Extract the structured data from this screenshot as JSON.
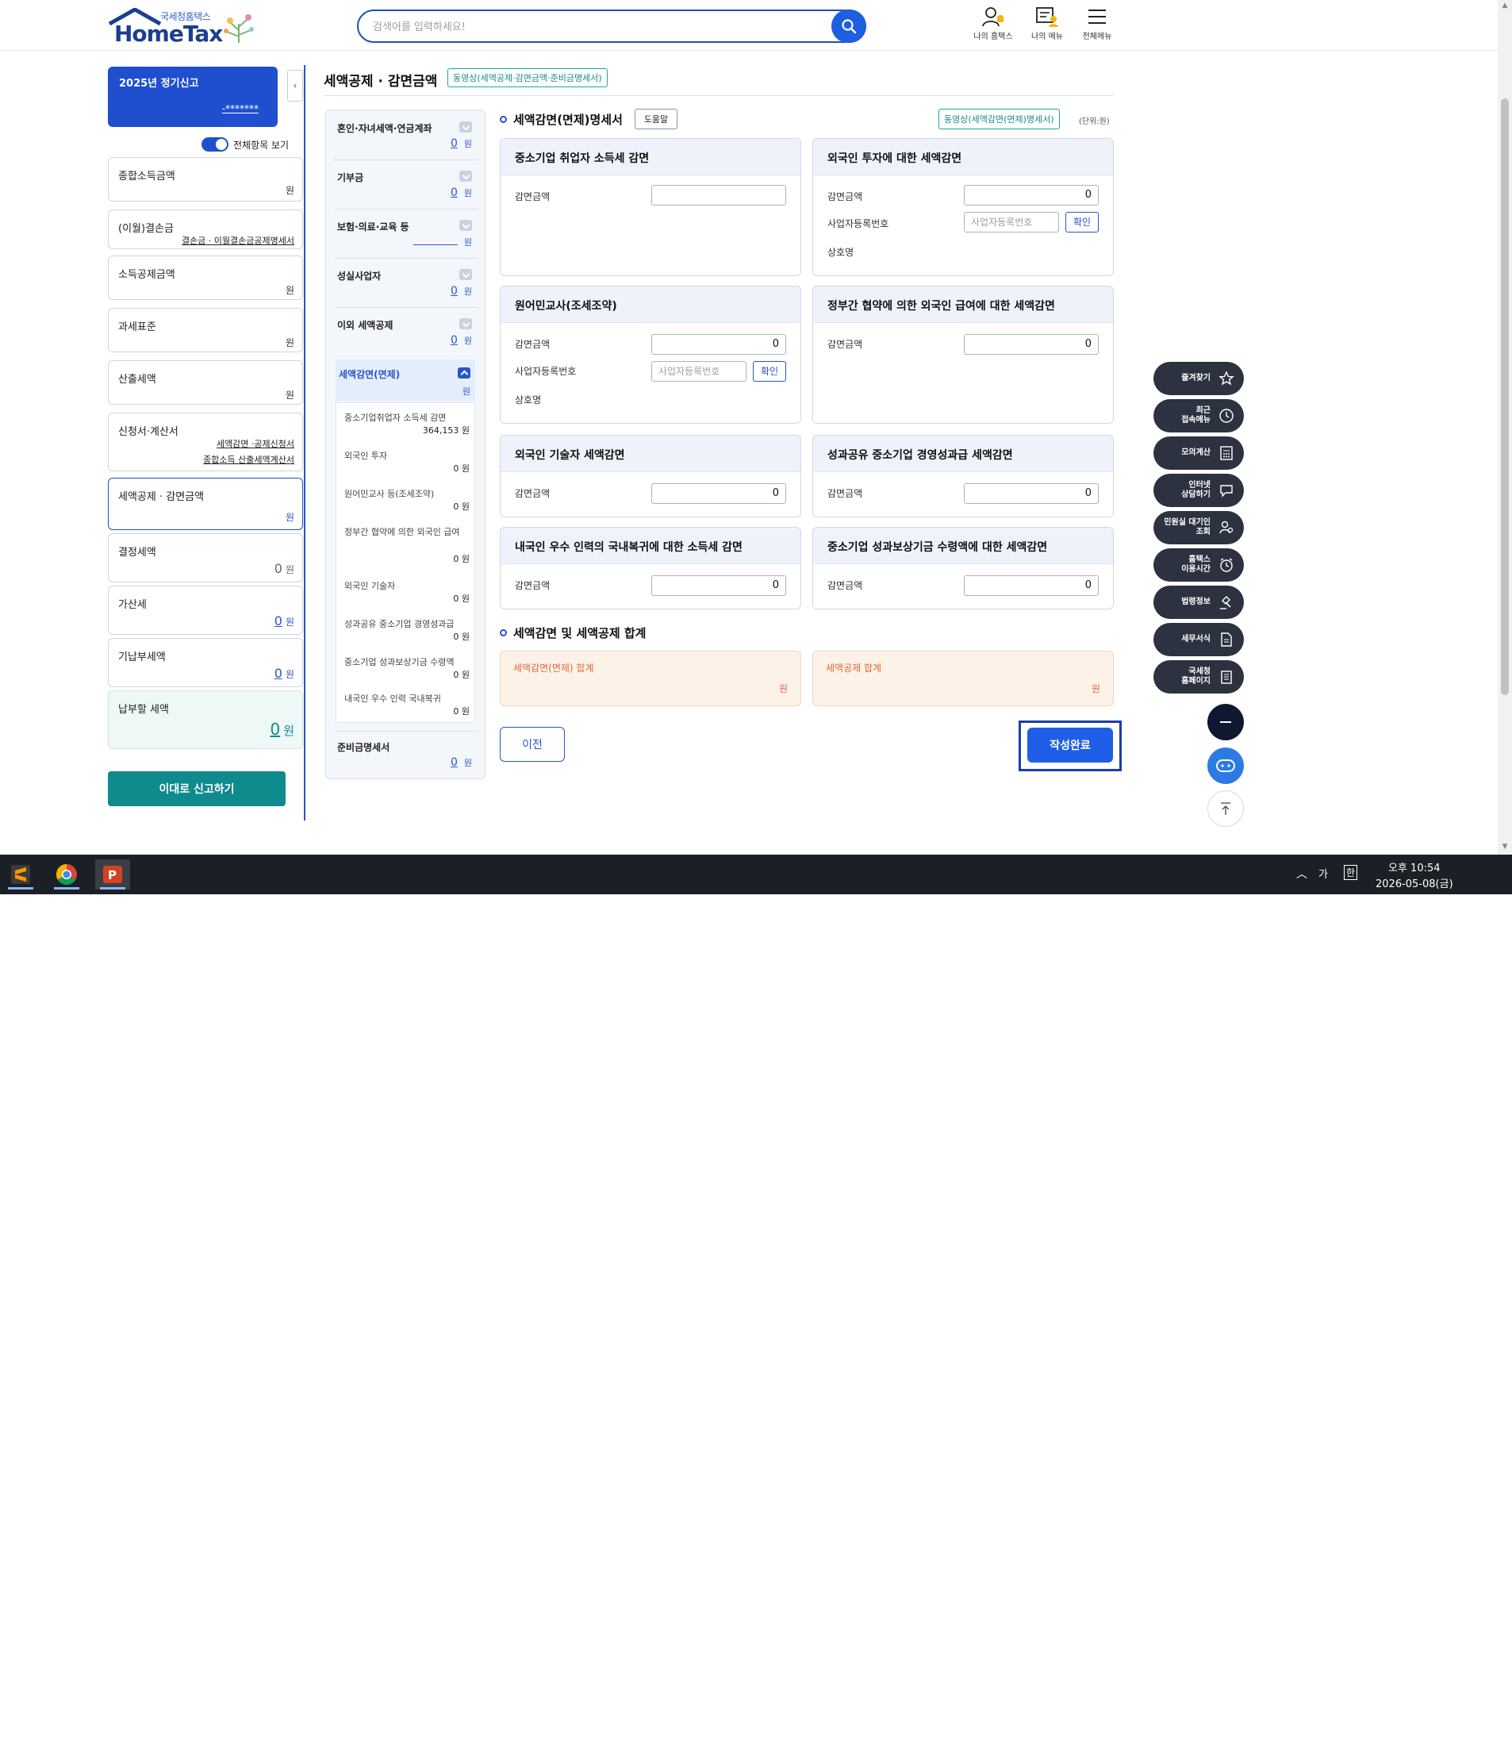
{
  "header": {
    "logo_sub": "국세청홈택스",
    "logo_main": "HomeTax",
    "search_placeholder": "검색어를 입력하세요!",
    "icons": [
      {
        "label": "나의 홈택스",
        "icon": "person-bell-icon"
      },
      {
        "label": "나의 메뉴",
        "icon": "my-menu-icon"
      },
      {
        "label": "전체메뉴",
        "icon": "hamburger-menu-icon"
      }
    ]
  },
  "left": {
    "filing_title": "2025년 정기신고",
    "masked_id": "-*******",
    "toggle_label": "전체항목 보기",
    "items": [
      {
        "label": "종합소득금액",
        "value": "",
        "unit": "원"
      },
      {
        "label": "(이월)결손금",
        "link": "결손금 · 이월결손금공제명세서"
      },
      {
        "label": "소득공제금액",
        "value": "",
        "unit": "원"
      },
      {
        "label": "과세표준",
        "value": "",
        "unit": "원"
      },
      {
        "label": "산출세액",
        "value": "",
        "unit": "원"
      },
      {
        "label": "신청서·계산서",
        "link1": "세액감면 ·공제신청서",
        "link2": "종합소득 산출세액계산서"
      },
      {
        "label": "세액공제 · 감면금액",
        "value": "",
        "unit": "원"
      },
      {
        "label": "결정세액",
        "value": "0",
        "unit": "원"
      },
      {
        "label": "가산세",
        "value": "0",
        "unit": "원"
      },
      {
        "label": "기납부세액",
        "value": "0",
        "unit": "원"
      },
      {
        "label": "납부할 세액",
        "value": "0",
        "unit": "원"
      }
    ],
    "report_button": "이대로 신고하기"
  },
  "title": {
    "text": "세액공제 · 감면금액",
    "video_tag": "동영상(세액공제·감면금액·준비금명세서)"
  },
  "nav": {
    "items": [
      {
        "label": "혼인·자녀세액·연금계좌",
        "value": "0",
        "unit": "원"
      },
      {
        "label": "기부금",
        "value": "0",
        "unit": "원"
      },
      {
        "label": "보험·의료·교육 등",
        "value": "",
        "unit": "원"
      },
      {
        "label": "성실사업자",
        "value": "0",
        "unit": "원"
      },
      {
        "label": "이외 세액공제",
        "value": "0",
        "unit": "원"
      }
    ],
    "active": {
      "label": "세액감면(면제)",
      "unit": "원"
    },
    "sub_items": [
      {
        "label": "중소기업취업자 소득세 감면",
        "value": "364,153 원"
      },
      {
        "label": "외국인 투자",
        "value": "0 원"
      },
      {
        "label": "원어민교사 등(조세조약)",
        "value": "0 원"
      },
      {
        "label": "정부간 협약에 의한 외국인 급여",
        "value": "0 원"
      },
      {
        "label": "외국인 기술자",
        "value": "0 원"
      },
      {
        "label": "성과공유 중소기업 경영성과급",
        "value": "0 원"
      },
      {
        "label": "중소기업 성과보상기금 수령액",
        "value": "0 원"
      },
      {
        "label": "내국인 우수 인력 국내복귀",
        "value": "0 원"
      }
    ],
    "last": {
      "label": "준비금명세서",
      "value": "0",
      "unit": "원"
    }
  },
  "content": {
    "section1_title": "세액감면(면제)명세서",
    "help_button": "도움말",
    "video_tag": "동영상(세액감면(면제)명세서)",
    "unit": "(단위:원)",
    "amount_label": "감면금액",
    "biz_label": "사업자등록번호",
    "biz_placeholder": "사업자등록번호",
    "confirm_label": "확인",
    "company_label": "상호명",
    "cards": [
      {
        "title": "중소기업 취업자 소득세 감면",
        "amount": ""
      },
      {
        "title": "외국인 투자에 대한 세액감면",
        "amount": "0"
      },
      {
        "title": "원어민교사(조세조약)",
        "amount": "0"
      },
      {
        "title": "정부간 협약에 의한 외국인 급여에 대한 세액감면",
        "amount": "0"
      },
      {
        "title": "외국인 기술자 세액감면",
        "amount": "0"
      },
      {
        "title": "성과공유 중소기업 경영성과급 세액감면",
        "amount": "0"
      },
      {
        "title": "내국인 우수 인력의 국내복귀에 대한 소득세 감면",
        "amount": "0"
      },
      {
        "title": "중소기업 성과보상기금 수령액에 대한  세액감면",
        "amount": "0"
      }
    ],
    "section2_title": "세액감면 및 세액공제 합계",
    "totals": [
      {
        "label": "세액감면(면제) 합계",
        "unit": "원"
      },
      {
        "label": "세액공제 합계",
        "unit": "원"
      }
    ],
    "prev_button": "이전",
    "done_button": "작성완료"
  },
  "quick_menu": [
    {
      "label": "즐겨찾기",
      "icon": "star-icon"
    },
    {
      "label": "최근\n접속메뉴",
      "icon": "clock-icon"
    },
    {
      "label": "모의계산",
      "icon": "calculator-icon"
    },
    {
      "label": "인터넷\n상담하기",
      "icon": "chat-icon"
    },
    {
      "label": "민원실 대기인\n조회",
      "icon": "person-search-icon"
    },
    {
      "label": "홈택스\n이용시간",
      "icon": "alarm-icon"
    },
    {
      "label": "법령정보",
      "icon": "gavel-icon"
    },
    {
      "label": "세무서식",
      "icon": "document-icon"
    },
    {
      "label": "국세청\n홈페이지",
      "icon": "building-icon"
    }
  ],
  "taskbar": {
    "ime1": "가",
    "ime2": "한",
    "time": "오후 10:54",
    "date": "2026-05-08(금)"
  }
}
